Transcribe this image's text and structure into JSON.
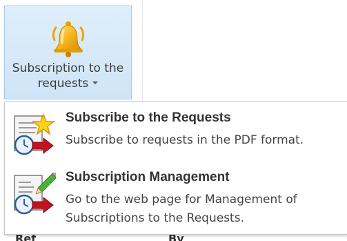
{
  "ribbon": {
    "button_label": "Subscription to the requests",
    "button_icon": "bell-icon"
  },
  "menu": {
    "items": [
      {
        "title": "Subscribe to the Requests",
        "description": "Subscribe to requests in the PDF format.",
        "icon": "subscribe-star-icon"
      },
      {
        "title": "Subscription Management",
        "description": "Go to the web page for Management of Subscriptions to the Requests.",
        "icon": "subscription-edit-icon"
      }
    ]
  },
  "background_peek": {
    "left_text": "Ref",
    "right_text": "By"
  },
  "colors": {
    "ribbon_button_bg": "#cfe4f7",
    "ribbon_button_border": "#a8c8ea",
    "menu_border": "#c6c6c6",
    "title_text": "#333333"
  }
}
